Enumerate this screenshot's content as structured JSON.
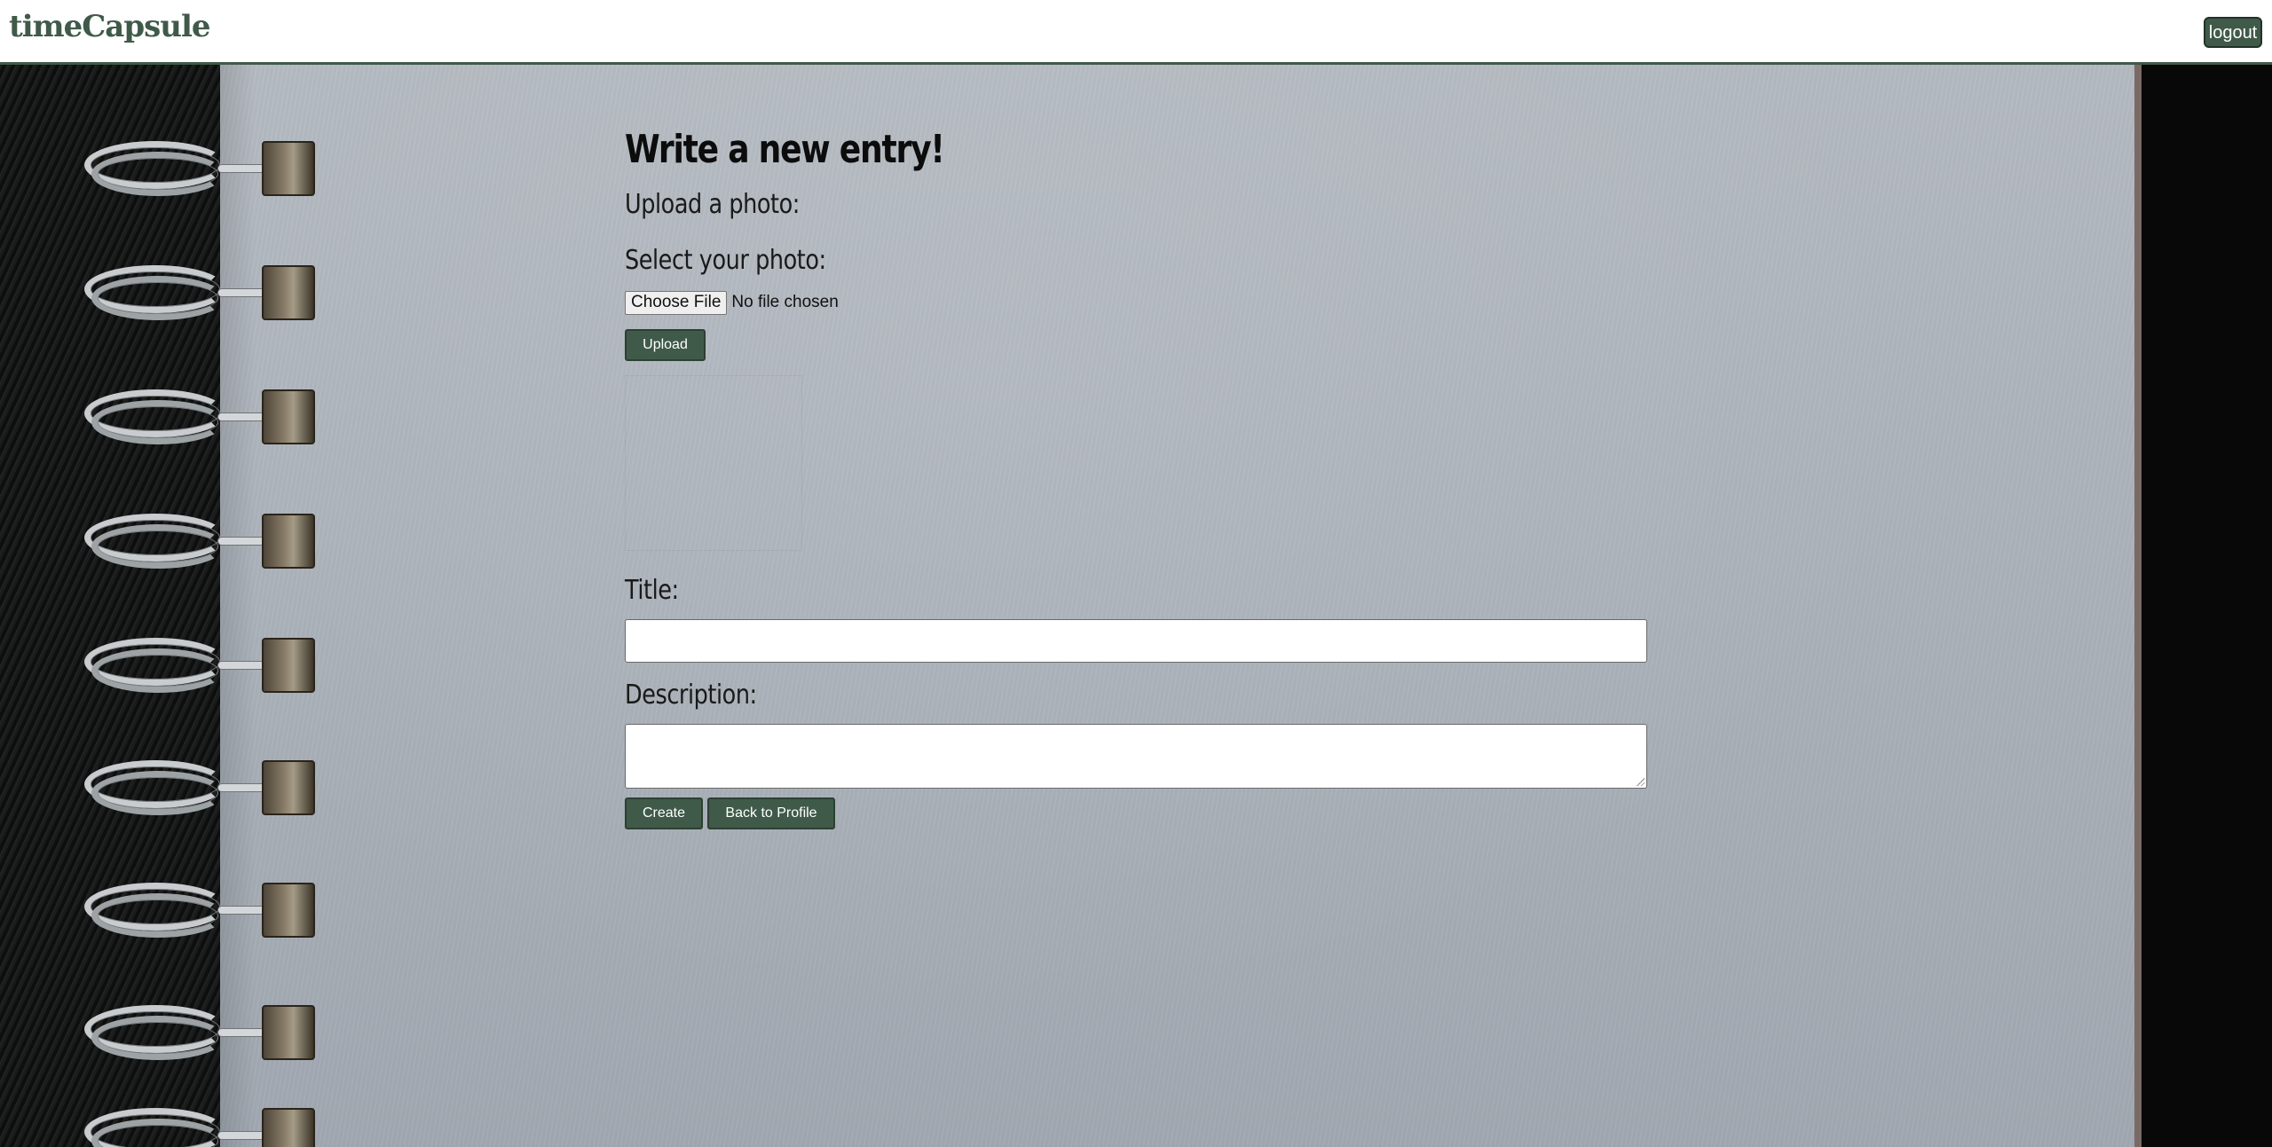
{
  "header": {
    "brand": "timeCapsule",
    "logout_label": "logout"
  },
  "form": {
    "heading": "Write a new entry!",
    "upload_section_label": "Upload a photo:",
    "select_photo_label": "Select your photo:",
    "file_input": {
      "button_label": "Choose File",
      "status": "No file chosen"
    },
    "upload_button": "Upload",
    "title_label": "Title:",
    "title_value": "",
    "description_label": "Description:",
    "description_value": "",
    "create_button": "Create",
    "back_button": "Back to Profile"
  },
  "colors": {
    "accent": "#3f5a49",
    "paper": "#aeb4bb",
    "input_bg": "#ffffff"
  }
}
